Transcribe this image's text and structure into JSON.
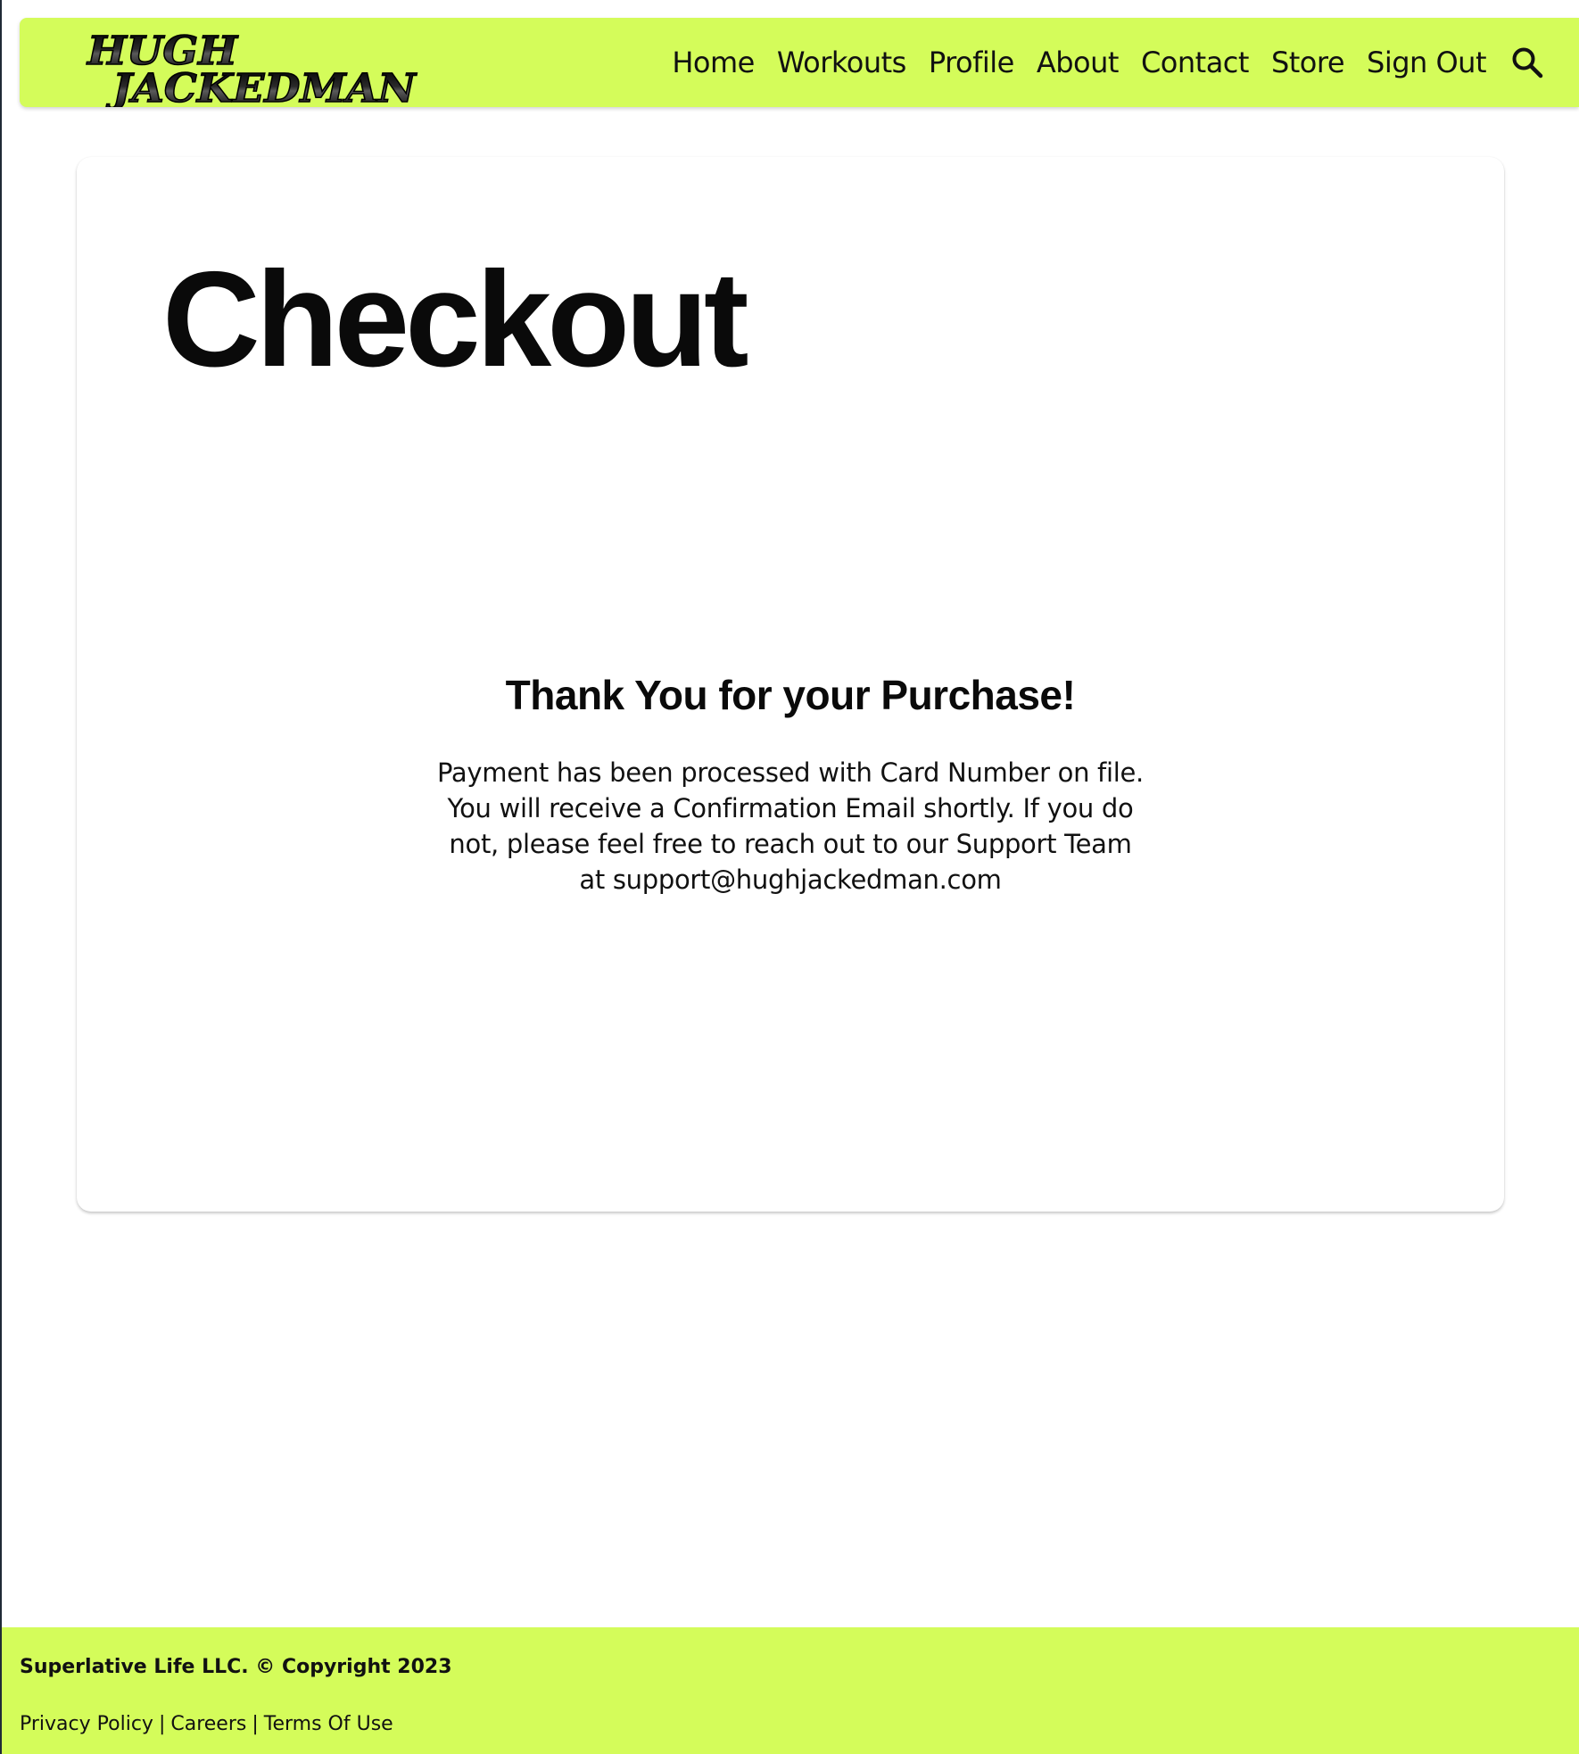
{
  "brand": {
    "logo_line1": "HUGH",
    "logo_line2": "JACKEDMAN"
  },
  "nav": {
    "items": [
      {
        "label": "Home"
      },
      {
        "label": "Workouts"
      },
      {
        "label": "Profile"
      },
      {
        "label": "About"
      },
      {
        "label": "Contact"
      },
      {
        "label": "Store"
      },
      {
        "label": "Sign Out"
      }
    ],
    "search_icon": "search-icon"
  },
  "main": {
    "title": "Checkout",
    "confirmation_heading": "Thank You for your Purchase!",
    "confirmation_message": "Payment has been processed with Card Number on file. You will receive a Confirmation Email shortly. If you do not, please feel free to reach out to our Support Team at support@hughjackedman.com"
  },
  "footer": {
    "copyright": "Superlative Life LLC. © Copyright 2023",
    "links": [
      {
        "label": "Privacy Policy"
      },
      {
        "label": "Careers"
      },
      {
        "label": "Terms Of Use"
      }
    ],
    "separator": "|"
  },
  "colors": {
    "accent": "#d4fc5a",
    "text": "#111111",
    "background": "#ffffff"
  }
}
